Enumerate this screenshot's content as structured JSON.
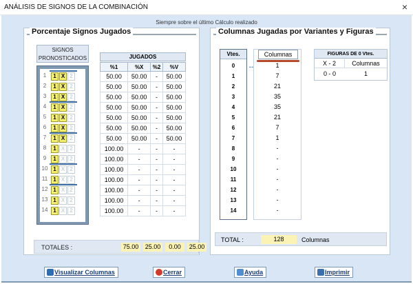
{
  "window": {
    "title": "ANÁLISIS DE SIGNOS DE LA COMBINACIÓN",
    "close_glyph": "×"
  },
  "subtitle": "Siempre sobre el último Cálculo realizado",
  "left_panel": {
    "title": "Porcentaje Signos Jugados",
    "signos_header": "SIGNOS PRONOSTICADOS",
    "jugados_header": "JUGADOS",
    "columns": [
      "%1",
      "%X",
      "%2",
      "%V"
    ],
    "rows": [
      {
        "n": "1",
        "signs": [
          "1",
          "X",
          "2"
        ],
        "on": [
          true,
          true,
          false
        ],
        "vals": [
          "50.00",
          "50.00",
          "-",
          "50.00"
        ]
      },
      {
        "n": "2",
        "signs": [
          "1",
          "X",
          "2"
        ],
        "on": [
          true,
          true,
          false
        ],
        "vals": [
          "50.00",
          "50.00",
          "-",
          "50.00"
        ]
      },
      {
        "n": "3",
        "signs": [
          "1",
          "X",
          "2"
        ],
        "on": [
          true,
          true,
          false
        ],
        "vals": [
          "50.00",
          "50.00",
          "-",
          "50.00"
        ]
      },
      {
        "n": "4",
        "signs": [
          "1",
          "X",
          "2"
        ],
        "on": [
          true,
          true,
          false
        ],
        "vals": [
          "50.00",
          "50.00",
          "-",
          "50.00"
        ]
      },
      {
        "n": "5",
        "signs": [
          "1",
          "X",
          "2"
        ],
        "on": [
          true,
          true,
          false
        ],
        "vals": [
          "50.00",
          "50.00",
          "-",
          "50.00"
        ]
      },
      {
        "n": "6",
        "signs": [
          "1",
          "X",
          "2"
        ],
        "on": [
          true,
          true,
          false
        ],
        "vals": [
          "50.00",
          "50.00",
          "-",
          "50.00"
        ]
      },
      {
        "n": "7",
        "signs": [
          "1",
          "X",
          "2"
        ],
        "on": [
          true,
          true,
          false
        ],
        "vals": [
          "50.00",
          "50.00",
          "-",
          "50.00"
        ]
      },
      {
        "n": "8",
        "signs": [
          "1",
          "X",
          "2"
        ],
        "on": [
          true,
          false,
          false
        ],
        "vals": [
          "100.00",
          "-",
          "-",
          "-"
        ]
      },
      {
        "n": "9",
        "signs": [
          "1",
          "X",
          "2"
        ],
        "on": [
          true,
          false,
          false
        ],
        "vals": [
          "100.00",
          "-",
          "-",
          "-"
        ]
      },
      {
        "n": "10",
        "signs": [
          "1",
          "X",
          "2"
        ],
        "on": [
          true,
          false,
          false
        ],
        "vals": [
          "100.00",
          "-",
          "-",
          "-"
        ]
      },
      {
        "n": "11",
        "signs": [
          "1",
          "X",
          "2"
        ],
        "on": [
          true,
          false,
          false
        ],
        "vals": [
          "100.00",
          "-",
          "-",
          "-"
        ]
      },
      {
        "n": "12",
        "signs": [
          "1",
          "X",
          "2"
        ],
        "on": [
          true,
          false,
          false
        ],
        "vals": [
          "100.00",
          "-",
          "-",
          "-"
        ]
      },
      {
        "n": "13",
        "signs": [
          "1",
          "X",
          "2"
        ],
        "on": [
          true,
          false,
          false
        ],
        "vals": [
          "100.00",
          "-",
          "-",
          "-"
        ]
      },
      {
        "n": "14",
        "signs": [
          "1",
          "X",
          "2"
        ],
        "on": [
          true,
          false,
          false
        ],
        "vals": [
          "100.00",
          "-",
          "-",
          "-"
        ]
      }
    ],
    "totals_label": "TOTALES :",
    "totals": [
      "75.00",
      "25.00",
      "0.00",
      "25.00"
    ]
  },
  "right_panel": {
    "title": "Columnas Jugadas por Variantes y Figuras",
    "vtes_header": "Vtes.",
    "columnas_header": "Columnas",
    "variants": [
      "0",
      "1",
      "2",
      "3",
      "4",
      "5",
      "6",
      "7",
      "8",
      "9",
      "10",
      "11",
      "12",
      "13",
      "14"
    ],
    "columnas": [
      "1",
      "7",
      "21",
      "35",
      "35",
      "21",
      "7",
      "1",
      "-",
      "-",
      "-",
      "-",
      "-",
      "-",
      "-"
    ],
    "arrow_glyph": "↔",
    "figuras": {
      "title": "FIGURAS DE 0 Vtes.",
      "col1_header": "X - 2",
      "col2_header": "Columnas",
      "col1_value": "0 - 0",
      "col2_value": "1"
    },
    "total_label": "TOTAL :",
    "total_value": "128",
    "total_unit": "Columnas"
  },
  "buttons": {
    "visualizar": "Visualizar Columnas",
    "cerrar": "Cerrar",
    "ayuda": "Ayuda",
    "imprimir": "Imprimir"
  },
  "colors": {
    "accent": "#3a6ea5",
    "highlight": "#f5f06a",
    "total_field": "#fbf2b5",
    "underline": "#b54a2a"
  }
}
